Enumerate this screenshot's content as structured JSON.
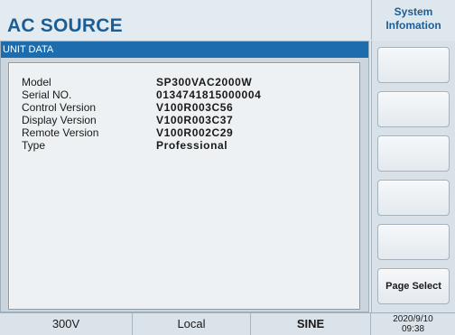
{
  "header": {
    "title": "AC SOURCE",
    "side_button": [
      "System",
      "Infomation"
    ]
  },
  "panel": {
    "title": "UNIT DATA",
    "rows": [
      {
        "label": "Model",
        "value": "SP300VAC2000W"
      },
      {
        "label": "Serial NO.",
        "value": "0134741815000004"
      },
      {
        "label": "Control Version",
        "value": "V100R003C56"
      },
      {
        "label": "Display Version",
        "value": "V100R003C37"
      },
      {
        "label": "Remote Version",
        "value": "V100R002C29"
      },
      {
        "label": "Type",
        "value": "Professional"
      }
    ]
  },
  "side_buttons": [
    "",
    "",
    "",
    "",
    "",
    "Page Select"
  ],
  "status": {
    "voltage": "300V",
    "mode": "Local",
    "waveform": "SINE",
    "date": "2020/9/10",
    "time": "09:38"
  }
}
